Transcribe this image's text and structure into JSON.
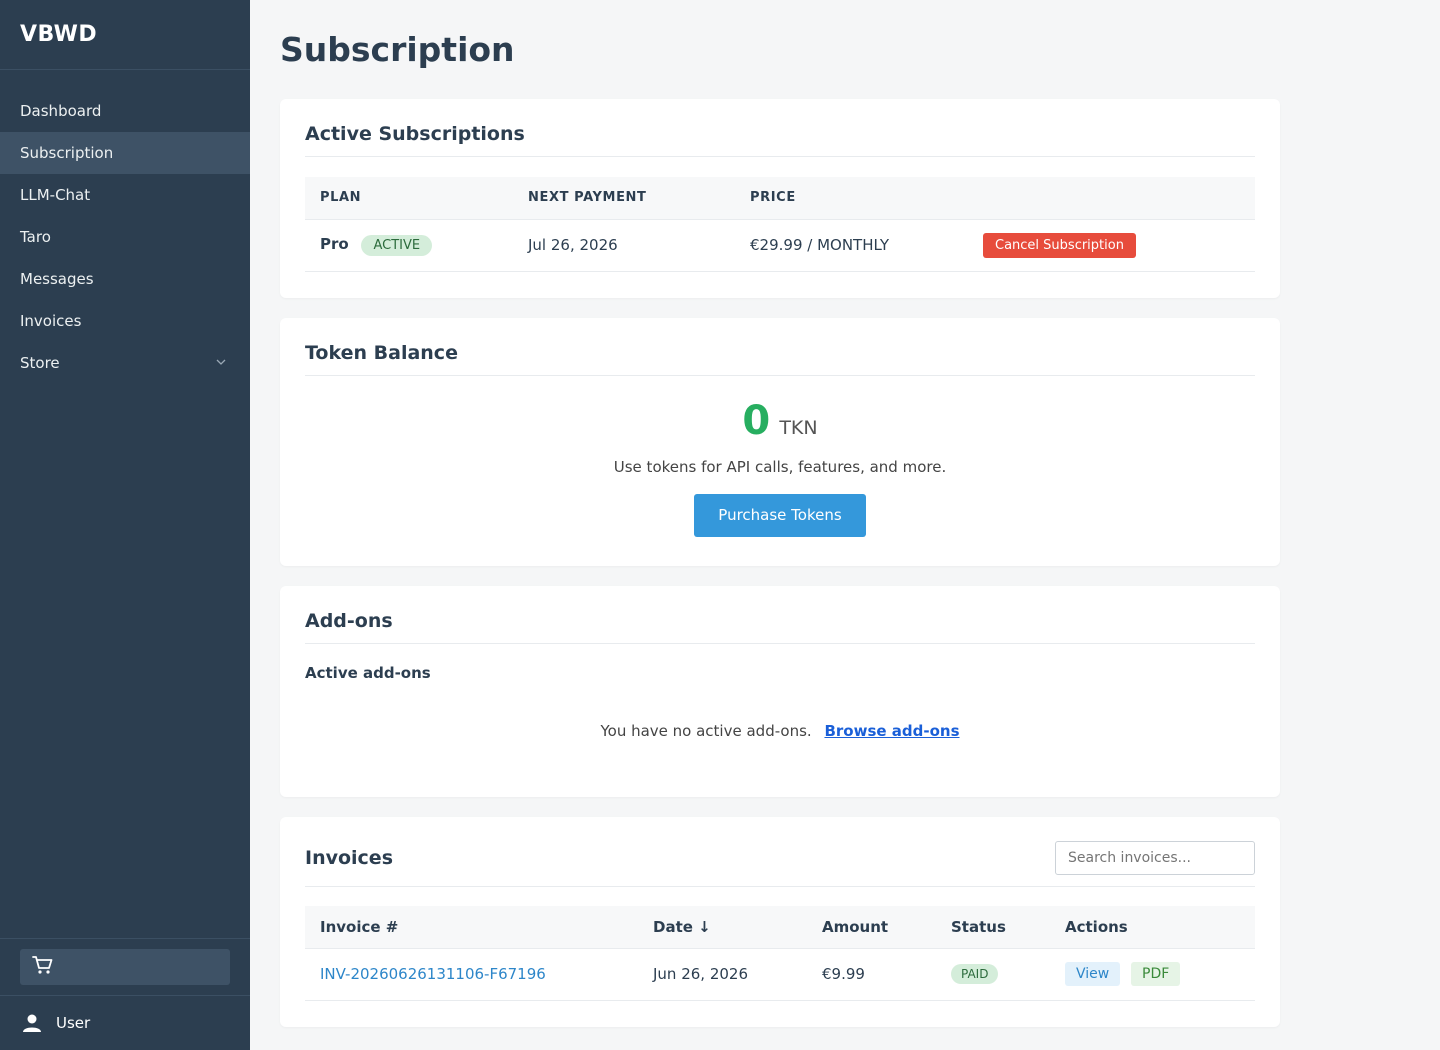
{
  "sidebar": {
    "brand": "VBWD",
    "items": [
      {
        "label": "Dashboard"
      },
      {
        "label": "Subscription"
      },
      {
        "label": "LLM-Chat"
      },
      {
        "label": "Taro"
      },
      {
        "label": "Messages"
      },
      {
        "label": "Invoices"
      },
      {
        "label": "Store"
      }
    ],
    "user_label": "User"
  },
  "page": {
    "title": "Subscription"
  },
  "active_subscriptions": {
    "title": "Active Subscriptions",
    "headers": [
      "PLAN",
      "NEXT PAYMENT",
      "PRICE"
    ],
    "row": {
      "plan": "Pro",
      "status": "ACTIVE",
      "next_payment": "Jul 26, 2026",
      "price": "€29.99 / MONTHLY",
      "action": "Cancel Subscription"
    }
  },
  "token_balance": {
    "title": "Token Balance",
    "amount": "0",
    "unit": "TKN",
    "description": "Use tokens for API calls, features, and more.",
    "button": "Purchase Tokens"
  },
  "addons": {
    "title": "Add-ons",
    "subtitle": "Active add-ons",
    "empty_text": "You have no active add-ons.",
    "link": "Browse add-ons"
  },
  "invoices": {
    "title": "Invoices",
    "search_placeholder": "Search invoices...",
    "headers": {
      "number": "Invoice #",
      "date": "Date ↓",
      "amount": "Amount",
      "status": "Status",
      "actions": "Actions"
    },
    "rows": [
      {
        "number": "INV-20260626131106-F67196",
        "date": "Jun 26, 2026",
        "amount": "€9.99",
        "status": "PAID",
        "view": "View",
        "pdf": "PDF"
      }
    ]
  }
}
